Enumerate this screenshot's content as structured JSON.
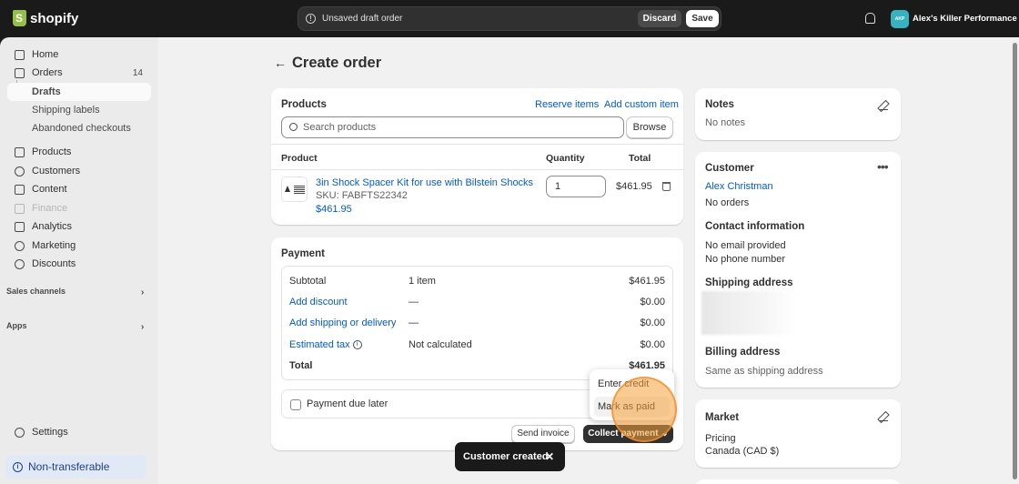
{
  "topbar": {
    "brand": "shopify",
    "unsaved_text": "Unsaved draft order",
    "discard_label": "Discard",
    "save_label": "Save",
    "avatar_initials": "AKP",
    "store_name": "Alex's Killer Performance"
  },
  "sidebar": {
    "items": [
      {
        "label": "Home"
      },
      {
        "label": "Orders",
        "count": "14"
      },
      {
        "label": "Drafts"
      },
      {
        "label": "Shipping labels"
      },
      {
        "label": "Abandoned checkouts"
      },
      {
        "label": "Products"
      },
      {
        "label": "Customers"
      },
      {
        "label": "Content"
      },
      {
        "label": "Finance"
      },
      {
        "label": "Analytics"
      },
      {
        "label": "Marketing"
      },
      {
        "label": "Discounts"
      }
    ],
    "sales_channels": "Sales channels",
    "apps": "Apps",
    "settings": "Settings",
    "non_transferable": "Non-transferable"
  },
  "page": {
    "title": "Create order"
  },
  "products": {
    "heading": "Products",
    "reserve_items": "Reserve items",
    "add_custom_item": "Add custom item",
    "search_placeholder": "Search products",
    "browse_label": "Browse",
    "col_product": "Product",
    "col_quantity": "Quantity",
    "col_total": "Total",
    "line_item": {
      "name": "3in Shock Spacer Kit for use with Bilstein Shocks",
      "sku": "SKU: FABFTS22342",
      "price": "$461.95",
      "quantity": "1",
      "total": "$461.95"
    }
  },
  "payment": {
    "heading": "Payment",
    "subtotal_label": "Subtotal",
    "subtotal_qty": "1 item",
    "subtotal_value": "$461.95",
    "discount_label": "Add discount",
    "discount_dash": "—",
    "discount_value": "$0.00",
    "shipping_label": "Add shipping or delivery",
    "shipping_dash": "—",
    "shipping_value": "$0.00",
    "tax_label": "Estimated tax",
    "tax_note": "Not calculated",
    "tax_value": "$0.00",
    "total_label": "Total",
    "total_value": "$461.95",
    "due_later_label": "Payment due later",
    "send_invoice": "Send invoice",
    "collect_payment": "Collect payment",
    "menu": [
      "Enter credit card",
      "Mark as paid"
    ]
  },
  "toast": {
    "text": "Customer created",
    "close": "✕"
  },
  "notes": {
    "heading": "Notes",
    "text": "No notes"
  },
  "customer": {
    "heading": "Customer",
    "name": "Alex Christman",
    "orders": "No orders",
    "contact_heading": "Contact information",
    "email": "No email provided",
    "phone": "No phone number",
    "shipping_heading": "Shipping address",
    "billing_heading": "Billing address",
    "billing_text": "Same as shipping address"
  },
  "market": {
    "heading": "Market",
    "pricing_label": "Pricing",
    "pricing_value": "Canada (CAD $)"
  }
}
